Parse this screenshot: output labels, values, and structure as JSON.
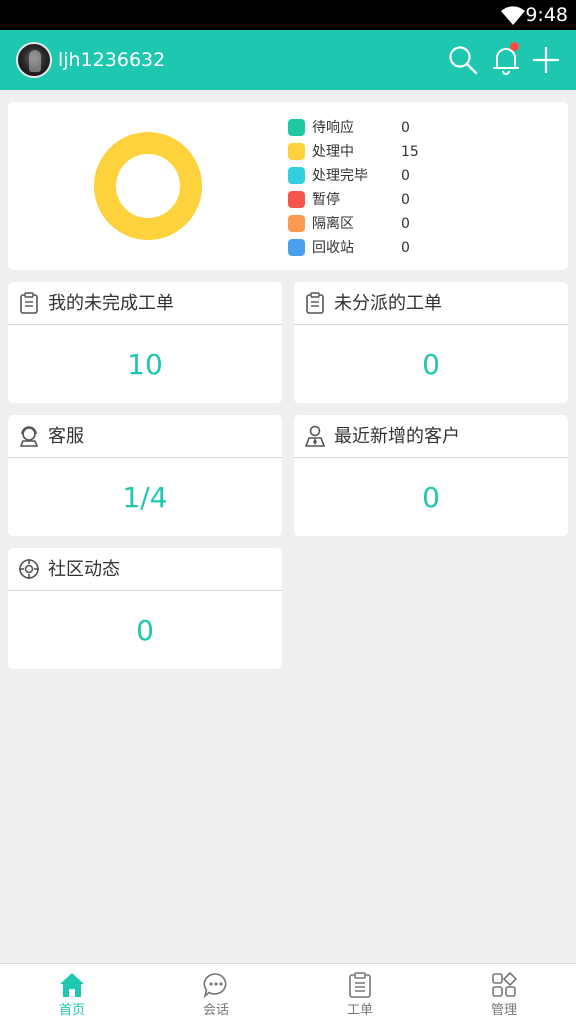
{
  "status_bar": {
    "time": "9:48",
    "wifi_icon": "wifi-icon"
  },
  "app_bar": {
    "username": "ljh1236632",
    "actions": [
      "search-icon",
      "bell-icon",
      "plus-icon"
    ],
    "accent_color": "#1ec8b0"
  },
  "summary": {
    "legend": [
      {
        "label": "待响应",
        "value": "0",
        "color": "#1ec8a0"
      },
      {
        "label": "处理中",
        "value": "15",
        "color": "#fdd23c"
      },
      {
        "label": "处理完毕",
        "value": "0",
        "color": "#33cfe0"
      },
      {
        "label": "暂停",
        "value": "0",
        "color": "#f5554a"
      },
      {
        "label": "隔离区",
        "value": "0",
        "color": "#fd9a52"
      },
      {
        "label": "回收站",
        "value": "0",
        "color": "#4aa0ee"
      }
    ]
  },
  "tiles": [
    {
      "title": "我的未完成工单",
      "value": "10",
      "icon": "clipboard-icon"
    },
    {
      "title": "未分派的工单",
      "value": "0",
      "icon": "clipboard-icon"
    },
    {
      "title": "客服",
      "value": "1/4",
      "icon": "agent-icon"
    },
    {
      "title": "最近新增的客户",
      "value": "0",
      "icon": "user-tie-icon"
    },
    {
      "title": "社区动态",
      "value": "0",
      "icon": "target-icon"
    }
  ],
  "bottom_nav": [
    {
      "label": "首页",
      "icon": "home-icon",
      "active": true
    },
    {
      "label": "会话",
      "icon": "chat-bubble-icon",
      "active": false
    },
    {
      "label": "工单",
      "icon": "clipboard-icon",
      "active": false
    },
    {
      "label": "管理",
      "icon": "grid-icon",
      "active": false
    }
  ]
}
